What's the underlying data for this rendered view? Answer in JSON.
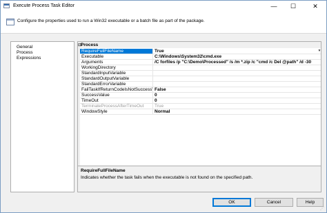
{
  "window": {
    "title": "Execute Process Task Editor",
    "minimize": "—",
    "maximize": "☐",
    "close": "✕"
  },
  "header": {
    "icon": "task-icon",
    "description": "Configure the properties used to run a Win32 executable or a batch file as part of the package."
  },
  "nav": {
    "items": [
      {
        "label": "General"
      },
      {
        "label": "Process",
        "selected": true
      },
      {
        "label": "Expressions"
      }
    ]
  },
  "grid": {
    "category": "Process",
    "toggle": "⊟",
    "selected_row": "RequireFullFileName",
    "rows": [
      {
        "name": "RequireFullFileName",
        "value": "True",
        "dropdown": "▼"
      },
      {
        "name": "Executable",
        "value": "C:\\Windows\\System32\\cmd.exe"
      },
      {
        "name": "Arguments",
        "value": "/C forfiles /p \"C:\\Demo\\Processed\" /s /m *.zip /c \"cmd /c Del @path\" /d -30"
      },
      {
        "name": "WorkingDirectory",
        "value": ""
      },
      {
        "name": "StandardInputVariable",
        "value": ""
      },
      {
        "name": "StandardOutputVariable",
        "value": ""
      },
      {
        "name": "StandardErrorVariable",
        "value": ""
      },
      {
        "name": "FailTaskIfReturnCodeIsNotSuccessValue",
        "value": "False"
      },
      {
        "name": "SuccessValue",
        "value": "0"
      },
      {
        "name": "TimeOut",
        "value": "0"
      },
      {
        "name": "TerminateProcessAfterTimeOut",
        "value": "True",
        "disabled": true
      },
      {
        "name": "WindowStyle",
        "value": "Normal"
      }
    ]
  },
  "description_pane": {
    "title": "RequireFullFileName",
    "text": "Indicates whether the task fails when the executable is not found on the specified path."
  },
  "buttons": {
    "ok": "OK",
    "cancel": "Cancel",
    "help": "Help"
  },
  "colors": {
    "selection": "#0078d7",
    "disabled_text": "#9c9c9c"
  }
}
